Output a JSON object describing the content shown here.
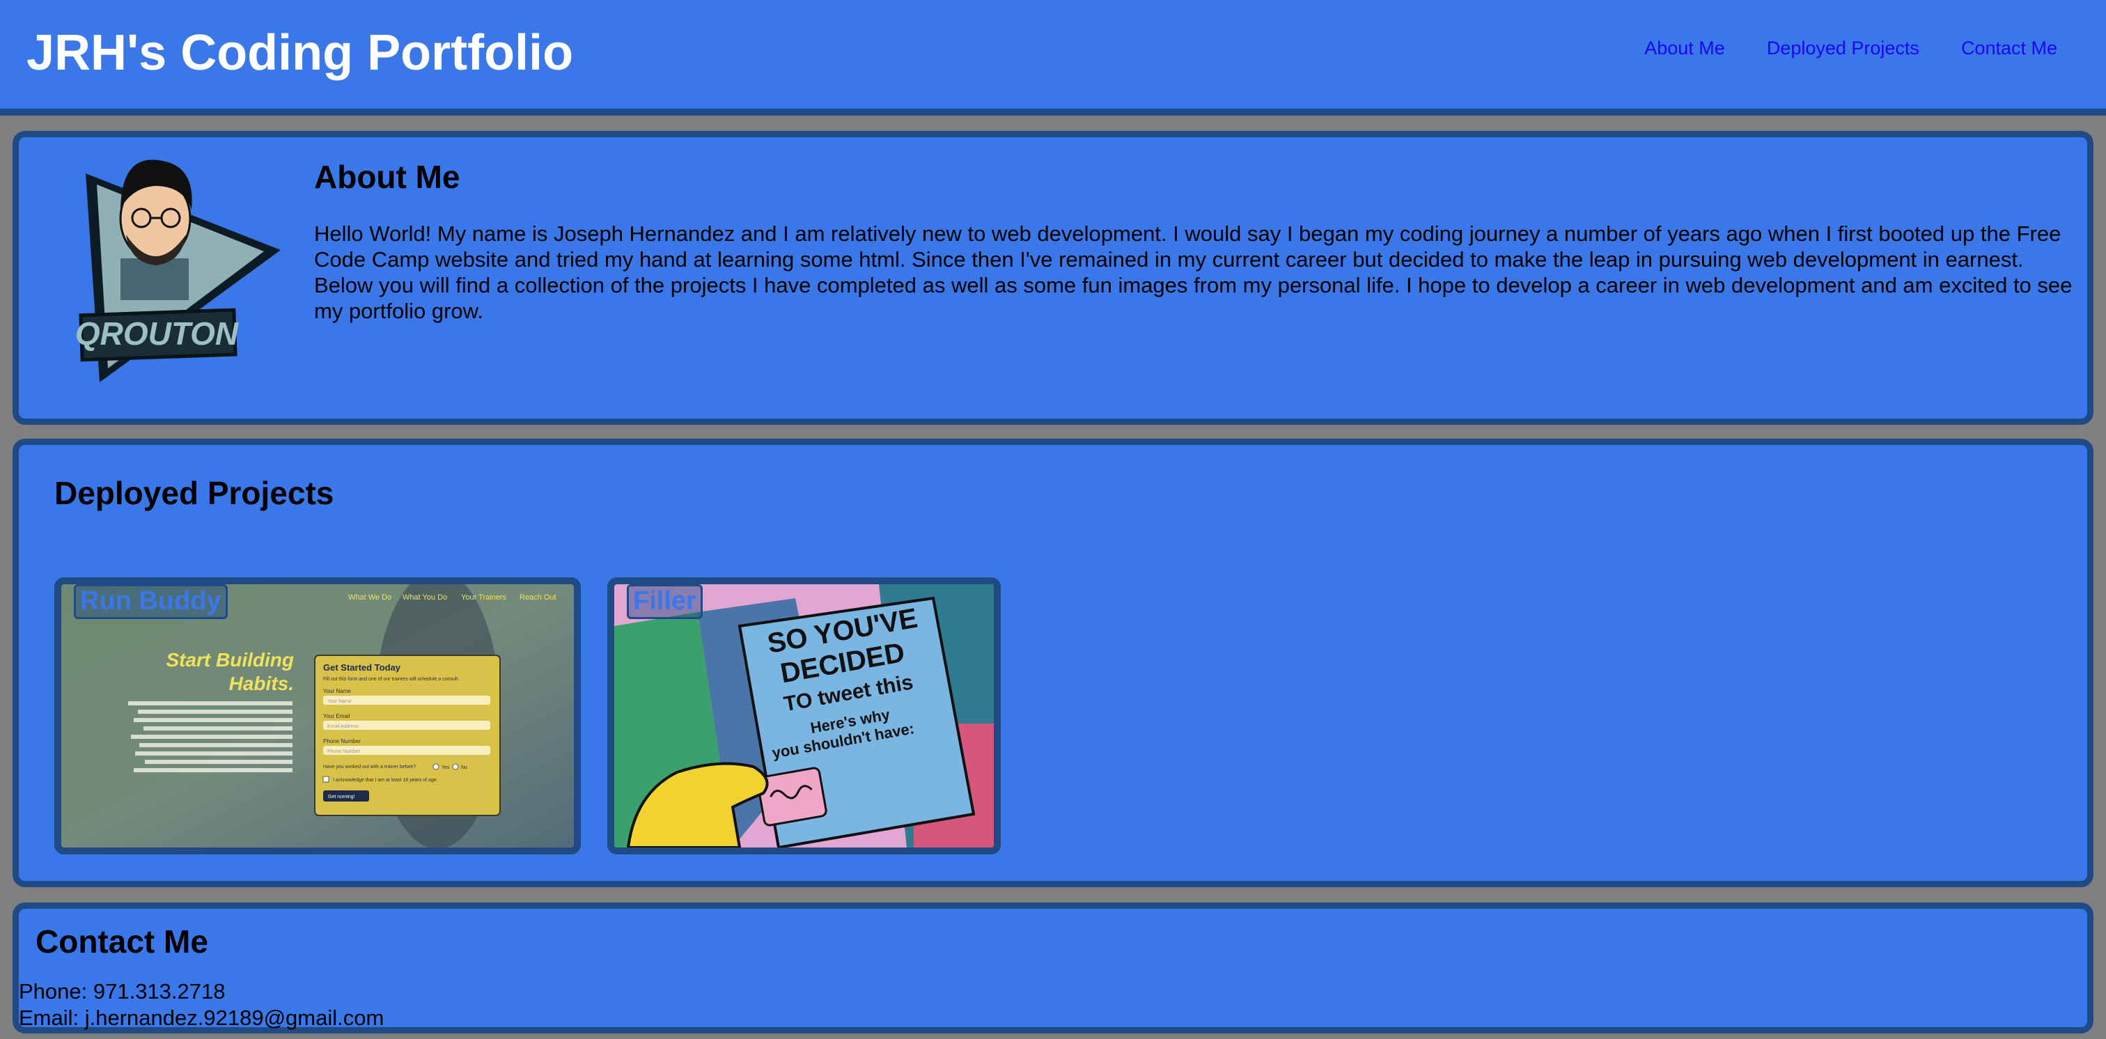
{
  "header": {
    "title": "JRH's Coding Portfolio",
    "nav": [
      "About Me",
      "Deployed Projects",
      "Contact Me"
    ]
  },
  "about": {
    "heading": "About Me",
    "avatar_label": "QROUTON",
    "body": "Hello World! My name is Joseph Hernandez and I am relatively new to web development. I would say I began my coding journey a number of years ago when I first booted up the Free Code Camp website and tried my hand at learning some html. Since then I've remained in my current career but decided to make the leap in pursuing web development in earnest. Below you will find a collection of the projects I have completed as well as some fun images from my personal life. I hope to develop a career in web development and am excited to see my portfolio grow."
  },
  "projects": {
    "heading": "Deployed Projects",
    "cards": [
      {
        "label": "Run Buddy",
        "screenshot": {
          "nav": [
            "What We Do",
            "What You Do",
            "Your Trainers",
            "Reach Out"
          ],
          "hero_line1": "Start Building",
          "hero_line2": "Habits.",
          "form_title": "Get Started Today",
          "form_sub": "Fill out this form and one of our trainers will schedule a consult.",
          "field1_label": "Your Name",
          "field1_placeholder": "Your Name",
          "field2_label": "Your Email",
          "field2_placeholder": "Email Address",
          "field3_label": "Phone Number",
          "field3_placeholder": "Phone Number",
          "question": "Have you worked out with a trainer before?",
          "yes": "Yes",
          "no": "No",
          "ack": "I acknowledge that I am at least 18 years of age.",
          "button": "Get running!"
        }
      },
      {
        "label": "Filler",
        "book_lines": [
          "SO YOU'VE",
          "DECIDED",
          "TO tweet this",
          "Here's why",
          "you shouldn't have:"
        ]
      }
    ]
  },
  "contact": {
    "heading": "Contact Me",
    "phone": "Phone: 971.313.2718",
    "email": "Email: j.hernandez.92189@gmail.com"
  },
  "colors": {
    "accent": "#3a77e9",
    "border": "#1f4a86",
    "page_background": "#7f7f7f",
    "nav_link": "#1a06f5"
  }
}
